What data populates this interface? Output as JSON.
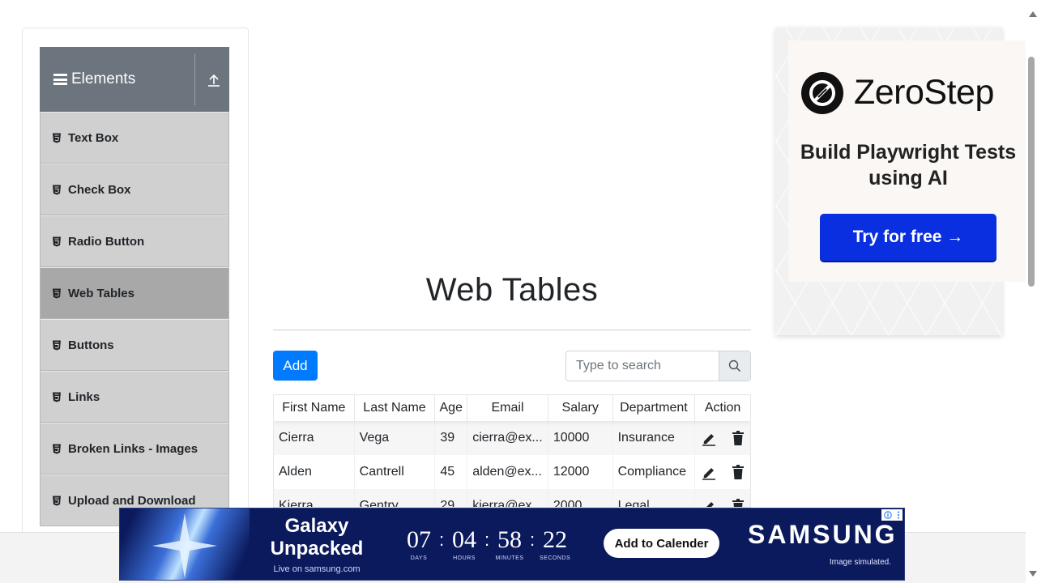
{
  "sidebar": {
    "group_title": "Elements",
    "items": [
      {
        "label": "Text Box"
      },
      {
        "label": "Check Box"
      },
      {
        "label": "Radio Button"
      },
      {
        "label": "Web Tables",
        "active": true
      },
      {
        "label": "Buttons"
      },
      {
        "label": "Links"
      },
      {
        "label": "Broken Links - Images"
      },
      {
        "label": "Upload and Download"
      }
    ]
  },
  "main": {
    "title": "Web Tables",
    "add_label": "Add",
    "search": {
      "placeholder": "Type to search",
      "value": ""
    },
    "table": {
      "headers": [
        "First Name",
        "Last Name",
        "Age",
        "Email",
        "Salary",
        "Department",
        "Action"
      ],
      "rows": [
        {
          "first": "Cierra",
          "last": "Vega",
          "age": "39",
          "email": "cierra@ex...",
          "salary": "10000",
          "department": "Insurance"
        },
        {
          "first": "Alden",
          "last": "Cantrell",
          "age": "45",
          "email": "alden@ex...",
          "salary": "12000",
          "department": "Compliance"
        },
        {
          "first": "Kierra",
          "last": "Gentry",
          "age": "29",
          "email": "kierra@ex...",
          "salary": "2000",
          "department": "Legal"
        }
      ]
    }
  },
  "ad_right": {
    "brand": "ZeroStep",
    "tagline": "Build Playwright Tests using AI",
    "cta": "Try for free →"
  },
  "ad_bottom": {
    "headline": "Galaxy Unpacked",
    "subline": "Live on samsung.com",
    "countdown": [
      {
        "value": "07",
        "label": "DAYS"
      },
      {
        "value": "04",
        "label": "HOURS"
      },
      {
        "value": "58",
        "label": "MINUTES"
      },
      {
        "value": "22",
        "label": "SECONDS"
      }
    ],
    "cta": "Add to Calender",
    "brand": "SAMSUNG",
    "note": "Image simulated."
  },
  "colors": {
    "primary": "#007bff",
    "sidebar_header": "#6c757d",
    "menu_item": "#d0d0d0",
    "menu_active": "#a8a8a8",
    "zerostep_cta": "#0a2fe0",
    "samsung_bg": "#0b1a5c"
  },
  "icons": {
    "menu": "hamburger-icon",
    "collapse": "upload-arrow-icon",
    "item": "document-icon",
    "search": "search-icon",
    "edit": "pencil-icon",
    "delete": "trash-icon"
  }
}
